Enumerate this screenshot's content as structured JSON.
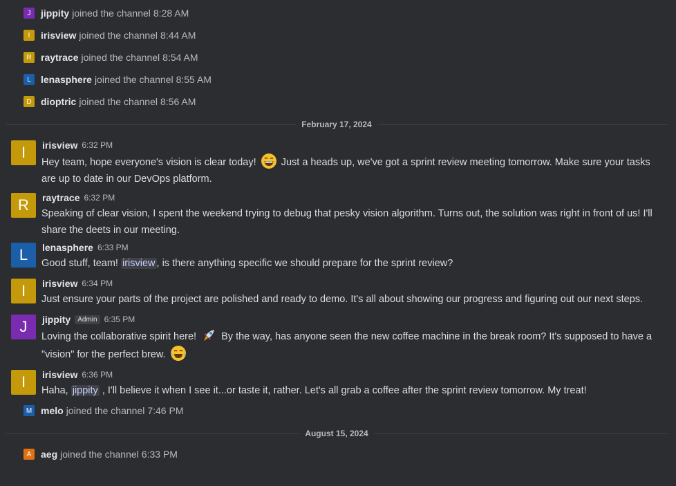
{
  "colors": {
    "background": "#2b2d31",
    "avatar_jippity": "#7a2bb0",
    "avatar_irisview": "#c49a0a",
    "avatar_raytrace": "#c49a0a",
    "avatar_lenasphere": "#1b5fa8",
    "avatar_dioptric": "#c49a0a",
    "avatar_melo": "#1b5fa8",
    "avatar_aeg": "#e0710f"
  },
  "joins_top": [
    {
      "initial": "J",
      "user": "jippity",
      "text": "joined the channel",
      "time": "8:28 AM"
    },
    {
      "initial": "I",
      "user": "irisview",
      "text": "joined the channel",
      "time": "8:44 AM"
    },
    {
      "initial": "R",
      "user": "raytrace",
      "text": "joined the channel",
      "time": "8:54 AM"
    },
    {
      "initial": "L",
      "user": "lenasphere",
      "text": "joined the channel",
      "time": "8:55 AM"
    },
    {
      "initial": "D",
      "user": "dioptric",
      "text": "joined the channel",
      "time": "8:56 AM"
    }
  ],
  "dividers": [
    "February 17, 2024",
    "August 15, 2024"
  ],
  "messages": [
    {
      "initial": "I",
      "author": "irisview",
      "time": "6:32 PM",
      "text_a": "Hey team, hope everyone's vision is clear today!",
      "emoji": "grinning-face",
      "text_b": "Just a heads up, we've got a sprint review meeting tomorrow. Make sure your tasks are up to date in our DevOps platform."
    },
    {
      "initial": "R",
      "author": "raytrace",
      "time": "6:32 PM",
      "text": "Speaking of clear vision, I spent the weekend trying to debug that pesky vision algorithm. Turns out, the solution was right in front of us! I'll share the deets in our meeting."
    },
    {
      "initial": "L",
      "author": "lenasphere",
      "time": "6:33 PM",
      "text_a": "Good stuff, team!",
      "mention": "irisview",
      "text_b": ", is there anything specific we should prepare for the sprint review?"
    },
    {
      "initial": "I",
      "author": "irisview",
      "time": "6:34 PM",
      "text": "Just ensure your parts of the project are polished and ready to demo. It's all about showing our progress and figuring out our next steps."
    },
    {
      "initial": "J",
      "author": "jippity",
      "badge": "Admin",
      "time": "6:35 PM",
      "text_a": "Loving the collaborative spirit here!",
      "emoji_a": "rocket",
      "text_b": "By the way, has anyone seen the new coffee machine in the break room? It's supposed to have a \"vision\" for the perfect brew.",
      "emoji_b": "tears-of-joy"
    },
    {
      "initial": "I",
      "author": "irisview",
      "time": "6:36 PM",
      "text_a": "Haha,",
      "mention": "jippity",
      "text_b": ", I'll believe it when I see it...or taste it, rather. Let's all grab a coffee after the sprint review tomorrow. My treat!"
    }
  ],
  "join_melo": {
    "initial": "M",
    "user": "melo",
    "text": "joined the channel",
    "time": "7:46 PM"
  },
  "join_aeg": {
    "initial": "A",
    "user": "aeg",
    "text": "joined the channel",
    "time": "6:33 PM"
  }
}
